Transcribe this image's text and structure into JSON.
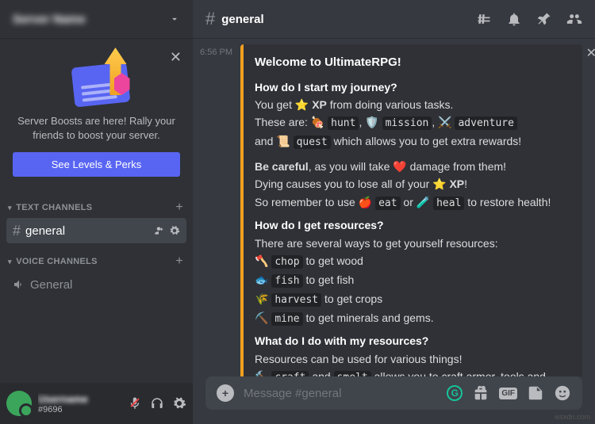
{
  "server": {
    "name": "Server Name"
  },
  "boost": {
    "text": "Server Boosts are here! Rally your friends to boost your server.",
    "button": "See Levels & Perks"
  },
  "sections": {
    "text_label": "TEXT CHANNELS",
    "voice_label": "VOICE CHANNELS"
  },
  "channels": {
    "text": [
      {
        "name": "general",
        "active": true
      }
    ],
    "voice": [
      {
        "name": "General"
      }
    ]
  },
  "user": {
    "name": "Username",
    "tag": "#9696"
  },
  "channel_header": {
    "name": "general"
  },
  "message": {
    "time": "6:56 PM",
    "title": "Welcome to UltimateRPG!",
    "h1": "How do I start my journey?",
    "p1a": "You get ",
    "xp": "XP",
    "p1b": " from doing various tasks.",
    "p2a": "These are: ",
    "hunt": "hunt",
    "p2b": ", ",
    "mission": "mission",
    "p2c": ", ",
    "adventure": "adventure",
    "p3a": "and ",
    "quest": "quest",
    "p3b": " which allows you to get extra rewards!",
    "p4a": "Be careful",
    "p4b": ", as you will take ",
    "p4c": " damage from them!",
    "p5a": "Dying causes you to lose all of your ",
    "p5b": "XP",
    "p5c": "!",
    "p6a": "So remember to use ",
    "eat": "eat",
    "p6b": " or ",
    "heal": "heal",
    "p6c": " to restore health!",
    "h2": "How do I get resources?",
    "r0": "There are several ways to get yourself resources:",
    "chop": "chop",
    "r1": " to get wood",
    "fish": "fish",
    "r2": " to get fish",
    "harvest": "harvest",
    "r3": " to get crops",
    "mine": "mine",
    "r4": " to get minerals and gems.",
    "h3": "What do I do with my resources?",
    "w0": "Resources can be used for various things!",
    "craft": "craft",
    "w1": " and ",
    "smelt": "smelt",
    "w2": " allows you to craft armor, tools and weapons!"
  },
  "input": {
    "placeholder": "Message #general",
    "gif": "GIF"
  },
  "watermark": "wsxdn.com"
}
